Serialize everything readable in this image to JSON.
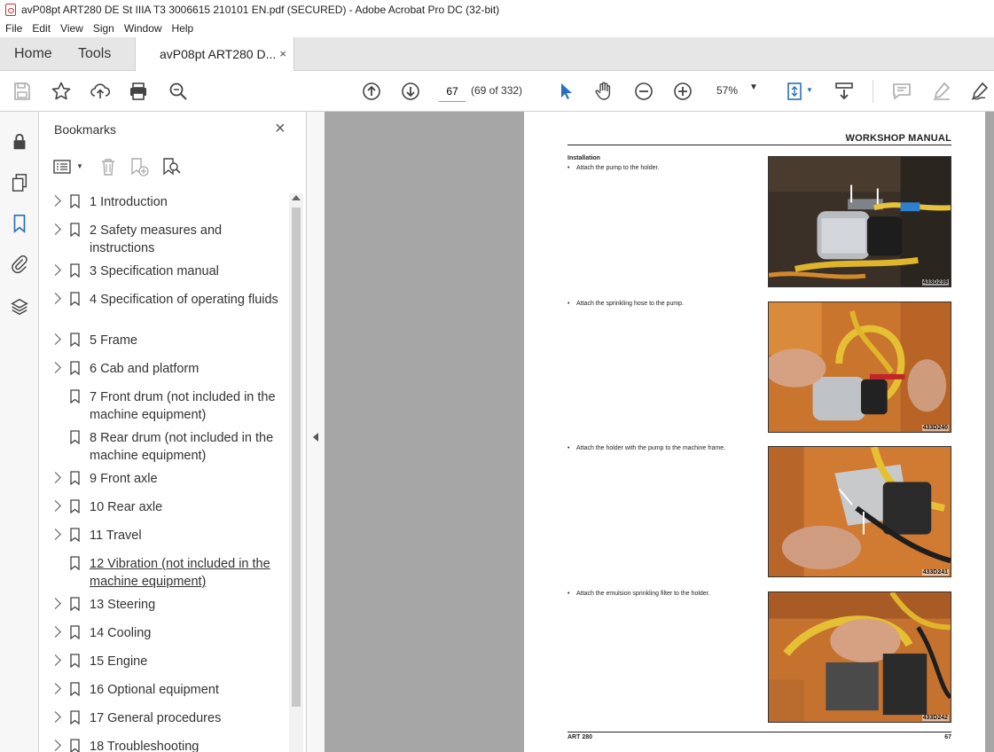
{
  "window": {
    "title": "avP08pt ART280 DE St IIIA T3 3006615 210101 EN.pdf (SECURED) - Adobe Acrobat Pro DC (32-bit)"
  },
  "menu": [
    "File",
    "Edit",
    "View",
    "Sign",
    "Window",
    "Help"
  ],
  "tabs": {
    "home": "Home",
    "tools": "Tools",
    "document": "avP08pt ART280 D...",
    "close": "×"
  },
  "toolbar": {
    "page_current": "67",
    "page_count": "(69 of 332)",
    "zoom": "57%",
    "icons": [
      "save-icon",
      "star-icon",
      "upload-icon",
      "print-icon",
      "search-icon",
      "page-up-icon",
      "page-down-icon",
      "select-arrow-icon",
      "hand-icon",
      "zoom-out-icon",
      "zoom-in-icon",
      "fit-page-icon",
      "scroll-mode-icon",
      "comment-icon",
      "highlight-icon",
      "sign-icon"
    ]
  },
  "bookmarks": {
    "title": "Bookmarks",
    "close": "×",
    "items": [
      {
        "label": "1 Introduction",
        "expandable": true
      },
      {
        "label": "2 Safety measures and instructions",
        "expandable": true
      },
      {
        "label": "3 Specification manual",
        "expandable": true
      },
      {
        "label": "4 Specification of operating fluids",
        "expandable": true
      },
      {
        "label": "5 Frame",
        "expandable": true
      },
      {
        "label": "6 Cab and platform",
        "expandable": true
      },
      {
        "label": "7 Front drum (not included in the machine equipment)",
        "expandable": false
      },
      {
        "label": "8 Rear drum (not included in the machine equipment)",
        "expandable": false
      },
      {
        "label": "9 Front axle",
        "expandable": true
      },
      {
        "label": "10 Rear axle",
        "expandable": true
      },
      {
        "label": "11 Travel",
        "expandable": true
      },
      {
        "label": "12 Vibration (not included in the machine equipment)",
        "expandable": false
      },
      {
        "label": "13 Steering",
        "expandable": true
      },
      {
        "label": "14 Cooling",
        "expandable": true
      },
      {
        "label": "15 Engine",
        "expandable": true
      },
      {
        "label": "16 Optional equipment",
        "expandable": true
      },
      {
        "label": "17 General procedures",
        "expandable": true
      },
      {
        "label": "18 Troubleshooting",
        "expandable": true
      }
    ]
  },
  "document": {
    "header": "WORKSHOP MANUAL",
    "section": "Installation",
    "bullet": "•",
    "steps": [
      {
        "text": "Attach the pump to the holder.",
        "image_code": "433D239"
      },
      {
        "text": "Attach the sprinkling hose to the pump.",
        "image_code": "433D240"
      },
      {
        "text": "Attach the holder with the pump to the machine frame.",
        "image_code": "433D241"
      },
      {
        "text": "Attach the emulsion sprinkling filter to the holder.",
        "image_code": "433D242"
      }
    ],
    "footer_left": "ART 280",
    "footer_right": "67"
  },
  "colors": {
    "accent_blue": "#2a6ebd",
    "pdf_red": "#d32f2f",
    "machine_orange": "#d9772c"
  }
}
